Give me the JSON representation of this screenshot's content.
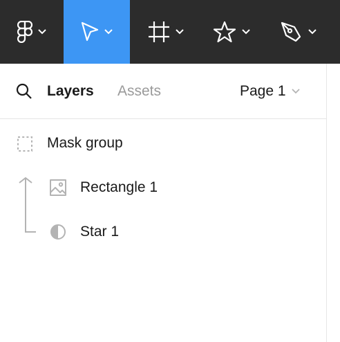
{
  "toolbar": {
    "tools": [
      {
        "name": "main-menu",
        "icon": "figma-logo-icon"
      },
      {
        "name": "move-tool",
        "icon": "cursor-arrow-icon",
        "active": true
      },
      {
        "name": "frame-tool",
        "icon": "frame-hash-icon"
      },
      {
        "name": "shape-tool",
        "icon": "star-icon"
      },
      {
        "name": "pen-tool",
        "icon": "pen-nib-icon"
      }
    ],
    "background": "#2c2c2c",
    "active_color": "#3d96f4"
  },
  "panel": {
    "tabs": {
      "layers_label": "Layers",
      "assets_label": "Assets"
    },
    "page_selector": {
      "label": "Page 1"
    },
    "layers": [
      {
        "label": "Mask group",
        "icon": "mask-group-icon"
      },
      {
        "label": "Rectangle 1",
        "icon": "image-icon"
      },
      {
        "label": "Star 1",
        "icon": "mask-half-circle-icon"
      }
    ]
  }
}
